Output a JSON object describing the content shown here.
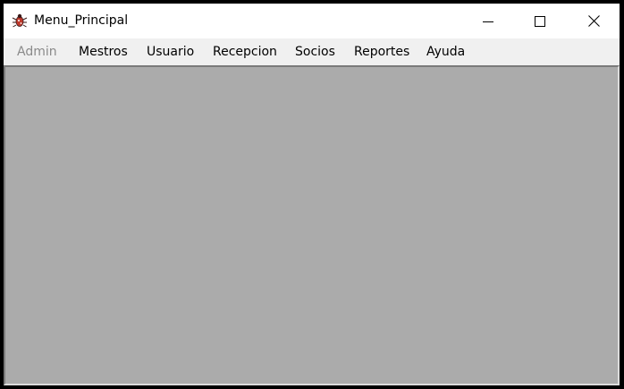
{
  "window": {
    "title": "Menu_Principal",
    "app_icon": "bug-app-icon",
    "controls": {
      "minimize_icon": "minimize-icon",
      "maximize_icon": "maximize-icon",
      "close_icon": "close-icon"
    }
  },
  "menubar": {
    "items": [
      {
        "label": "Admin",
        "enabled": false
      },
      {
        "label": "Mestros",
        "enabled": true
      },
      {
        "label": "Usuario",
        "enabled": true
      },
      {
        "label": "Recepcion",
        "enabled": true
      },
      {
        "label": "Socios",
        "enabled": true
      },
      {
        "label": "Reportes",
        "enabled": true
      },
      {
        "label": "Ayuda",
        "enabled": true
      }
    ]
  },
  "colors": {
    "frame": "#000000",
    "titlebar_bg": "#ffffff",
    "menubar_bg": "#f0f0f0",
    "menu_disabled_text": "#8a8a8a",
    "mdi_background": "#ababab"
  }
}
